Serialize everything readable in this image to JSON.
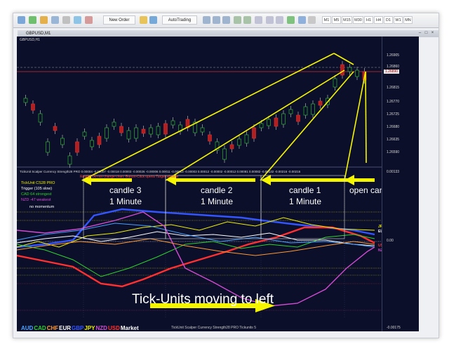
{
  "toolbar": {
    "new_order": "New Order",
    "autotrading": "AutoTrading",
    "timeframes": [
      "M1",
      "M5",
      "M15",
      "M30",
      "H1",
      "H4",
      "D1",
      "W1",
      "MN"
    ]
  },
  "window": {
    "title": "GBPUSD,M1"
  },
  "chart": {
    "symbol_label": "GBPUSD,H1",
    "price_levels": [
      "1.26905",
      "1.26860",
      "1.26815",
      "1.26770",
      "1.26725",
      "1.26680",
      "1.26635",
      "1.26590",
      "1.26545",
      "1.26500"
    ],
    "current_price": "1.26890",
    "indicator_header": "TickUnit Scalper Currency Strength28 PRO 0.00004 -0.00007 -0.00018 0.00003 -0.00026 -0.00006 0.00011 -0.00013 -0.00003 0.00012 -0.00002 -0.00012 0.00081 0.00082 -0.00132 -0.00216 -0.00216",
    "indicator_ready": "Ready! Do not change chart. Button-Click opens Target window",
    "indicator_info": [
      {
        "text": "TickUnit CS28 PRO",
        "color": "#f0f000"
      },
      {
        "text": "Trigger (105 slow)",
        "color": "#ffffff"
      },
      {
        "text": "CAD 64 strongest",
        "color": "#2fd12f"
      },
      {
        "text": "NZD -47 weakest",
        "color": "#d04bd0"
      },
      {
        "text": "no momentum",
        "color": "#ffffff"
      }
    ],
    "indicator_scale": [
      "0.00133",
      "0.00",
      "-0.00175"
    ],
    "side_labels": [
      {
        "text": "JPY",
        "color": "#f0f000"
      },
      {
        "text": "EUR",
        "color": "#ffffff"
      },
      {
        "text": "USD",
        "color": "#ff3030"
      },
      {
        "text": "NZD",
        "color": "#d04bd0"
      }
    ],
    "legend": [
      {
        "text": "AUD",
        "color": "#4aa0ff"
      },
      {
        "text": "CAD",
        "color": "#2fd12f"
      },
      {
        "text": "CHF",
        "color": "#ff9933"
      },
      {
        "text": "EUR",
        "color": "#ffffff"
      },
      {
        "text": "GBP",
        "color": "#3355ff"
      },
      {
        "text": "JPY",
        "color": "#f0f000"
      },
      {
        "text": "NZD",
        "color": "#d04bd0"
      },
      {
        "text": "USD",
        "color": "#ff3030"
      },
      {
        "text": "Market",
        "color": "#ffffff"
      }
    ],
    "legend_title": "TickUnit Scalper Currency Strength28 PRO  Tickunits 5"
  },
  "annotations": {
    "candle3": "candle 3",
    "candle3_sub": "1 Minute",
    "candle2": "candle 2",
    "candle2_sub": "1 Minute",
    "candle1": "candle 1",
    "candle1_sub": "1 Minute",
    "open_candle": "open candle",
    "moving_left": "Tick-Units moving to left"
  },
  "colors": {
    "accent_yellow": "#f5f500",
    "chart_bg": "#0b0f2a"
  }
}
